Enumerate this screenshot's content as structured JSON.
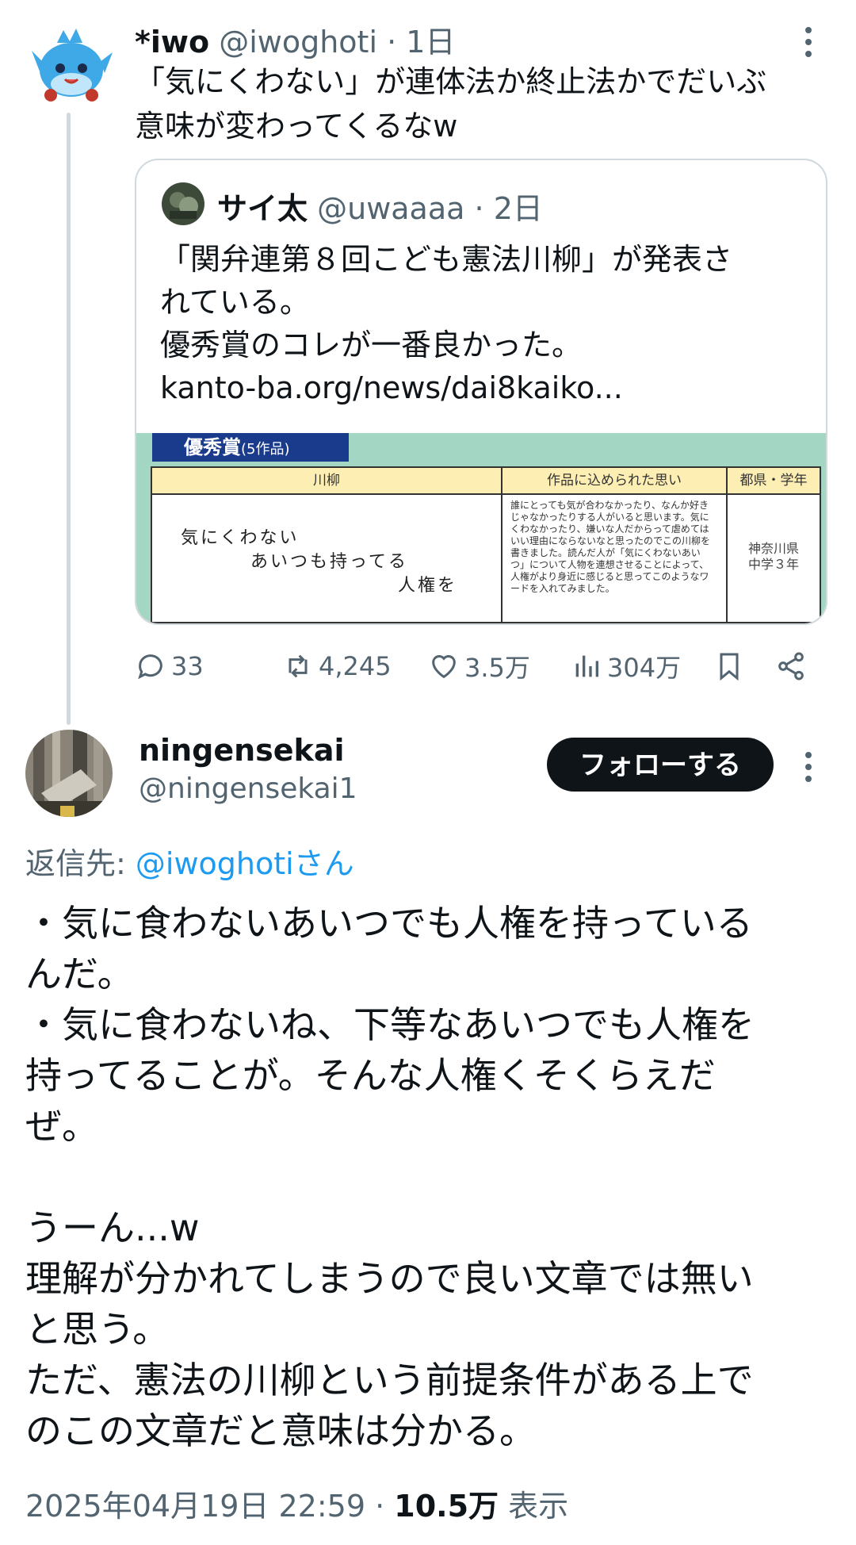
{
  "tweet1": {
    "display_name": "*iwo",
    "handle": "@iwoghoti",
    "time": "1日",
    "text_line1": "「気にくわない」が連体法か終止法かでだいぶ",
    "text_line2": "意味が変わってくるなw"
  },
  "quote": {
    "display_name": "サイ太",
    "handle": "@uwaaaa",
    "time": "2日",
    "text_lines": [
      "「関弁連第８回こども憲法川柳」が発表さ",
      "れている。",
      "優秀賞のコレが一番良かった。"
    ],
    "link": "kanto-ba.org/news/dai8kaiko...",
    "image": {
      "banner": "優秀賞",
      "banner_sub": "(5作品)",
      "col_poem": "川柳",
      "col_thought": "作品に込められた思い",
      "col_pref": "都県・学年",
      "poem_line1": "気にくわない",
      "poem_line2": "あいつも持ってる",
      "poem_line3": "人権を",
      "thought": "誰にとっても気が合わなかったり、なんか好きじゃなかったりする人がいると思います。気にくわなかったり、嫌いな人だからって虐めてはいい理由にならないなと思ったのでこの川柳を書きました。読んだ人が「気にくわないあいつ」について人物を連想させることによって、人権がより身近に感じると思ってこのようなワードを入れてみました。",
      "pref_line1": "神奈川県",
      "pref_line2": "中学３年"
    }
  },
  "actions": {
    "replies": "33",
    "retweets": "4,245",
    "likes": "3.5万",
    "views": "304万"
  },
  "tweet2": {
    "display_name": "ningensekai",
    "handle": "@ningensekai1",
    "follow_label": "フォローする",
    "reply_prefix": "返信先: ",
    "reply_mention": "@iwoghotiさん",
    "body": "・気に食わないあいつでも人権を持っている\nんだ。\n・気に食わないね、下等なあいつでも人権を\n持ってることが。そんな人権くそくらえだ\nぜ。\n\nうーん...w\n理解が分かれてしまうので良い文章では無い\nと思う。\nただ、憲法の川柳という前提条件がある上で\nのこの文章だと意味は分かる。",
    "datetime": "2025年04月19日 22:59",
    "view_count": "10.5万",
    "view_label": "表示"
  }
}
